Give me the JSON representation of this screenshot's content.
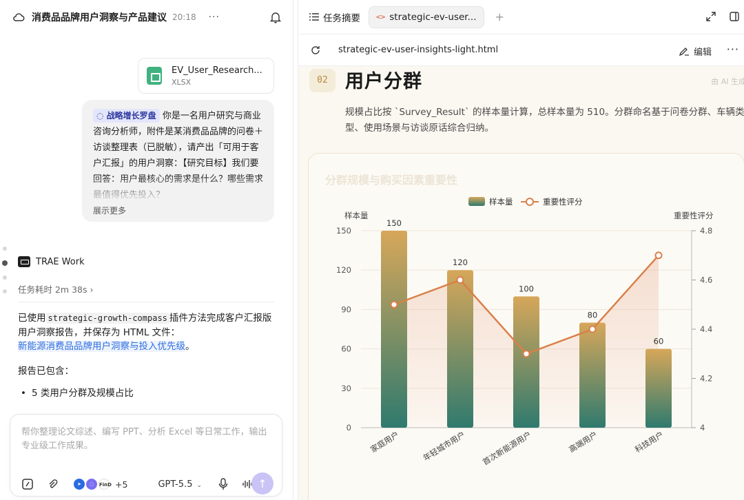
{
  "left": {
    "header": {
      "title": "消费品品牌用户洞察与产品建议",
      "time": "20:18"
    },
    "attachment": {
      "name": "EV_User_Research...",
      "ext": "XLSX"
    },
    "user_message": {
      "tag": "战略增长罗盘",
      "text": "你是一名用户研究与商业咨询分析师，附件是某消费品品牌的问卷＋访谈整理表（已脱敏），请产出「可用于客户汇报」的用户洞察：【研究目标】我们要回答：用户最核心的需求是什么？哪些需求最值得优先投入？",
      "expand": "展示更多"
    },
    "agent": {
      "name": "TRAE Work",
      "task_time": "任务耗时 2m 38s"
    },
    "reply": {
      "p1_before": "已使用",
      "plugin": "strategic-growth-compass",
      "p1_after": "插件方法完成客户汇报版用户洞察报告，并保存为 HTML 文件：",
      "link": "新能源消费品品牌用户洞察与投入优先级",
      "link_suffix": "。",
      "p2": "报告已包含：",
      "bullet1": "5 类用户分群及规模占比"
    },
    "composer": {
      "placeholder": "帮你整理论文综述、编写 PPT、分析 Excel 等日常工作，输出专业级工作成果。",
      "plugins_more": "+5",
      "model": "GPT-5.5"
    }
  },
  "right": {
    "tabs": {
      "summary": "任务摘要",
      "file": "strategic-ev-user..."
    },
    "url": {
      "filename": "strategic-ev-user-insights-light.html",
      "edit": "编辑"
    },
    "section": {
      "num": "02",
      "title": "用户分群",
      "ai_tag": "由 AI 生成",
      "desc": "规模占比按 `Survey_Result` 的样本量计算，总样本量为 510。分群命名基于问卷分群、车辆类型、使用场景与访谈原话综合归纳。"
    },
    "chart_card_title": "分群规模与购买因素重要性"
  },
  "colors": {
    "bar_top": "#d7a75a",
    "bar_bottom": "#2f7a6e",
    "line": "#d9804a",
    "accent_link": "#2f6fe0"
  },
  "chart_data": {
    "type": "bar",
    "categories": [
      "家庭用户",
      "年轻城市用户",
      "首次新能源用户",
      "高端用户",
      "科技用户"
    ],
    "series": [
      {
        "name": "样本量",
        "type": "bar",
        "axis": "left",
        "values": [
          150,
          120,
          100,
          80,
          60
        ]
      },
      {
        "name": "重要性评分",
        "type": "line",
        "axis": "right",
        "values": [
          4.5,
          4.6,
          4.3,
          4.4,
          4.7
        ]
      }
    ],
    "ylabel_left": "样本量",
    "ylabel_right": "重要性评分",
    "ylim_left": [
      0,
      150
    ],
    "yticks_left": [
      0,
      30,
      60,
      90,
      120,
      150
    ],
    "ylim_right": [
      4.0,
      4.8
    ],
    "yticks_right": [
      4,
      4.2,
      4.4,
      4.6,
      4.8
    ],
    "data_labels": [
      "150",
      "120",
      "100",
      "80",
      "60"
    ],
    "legend": "top-center",
    "grid": true
  }
}
